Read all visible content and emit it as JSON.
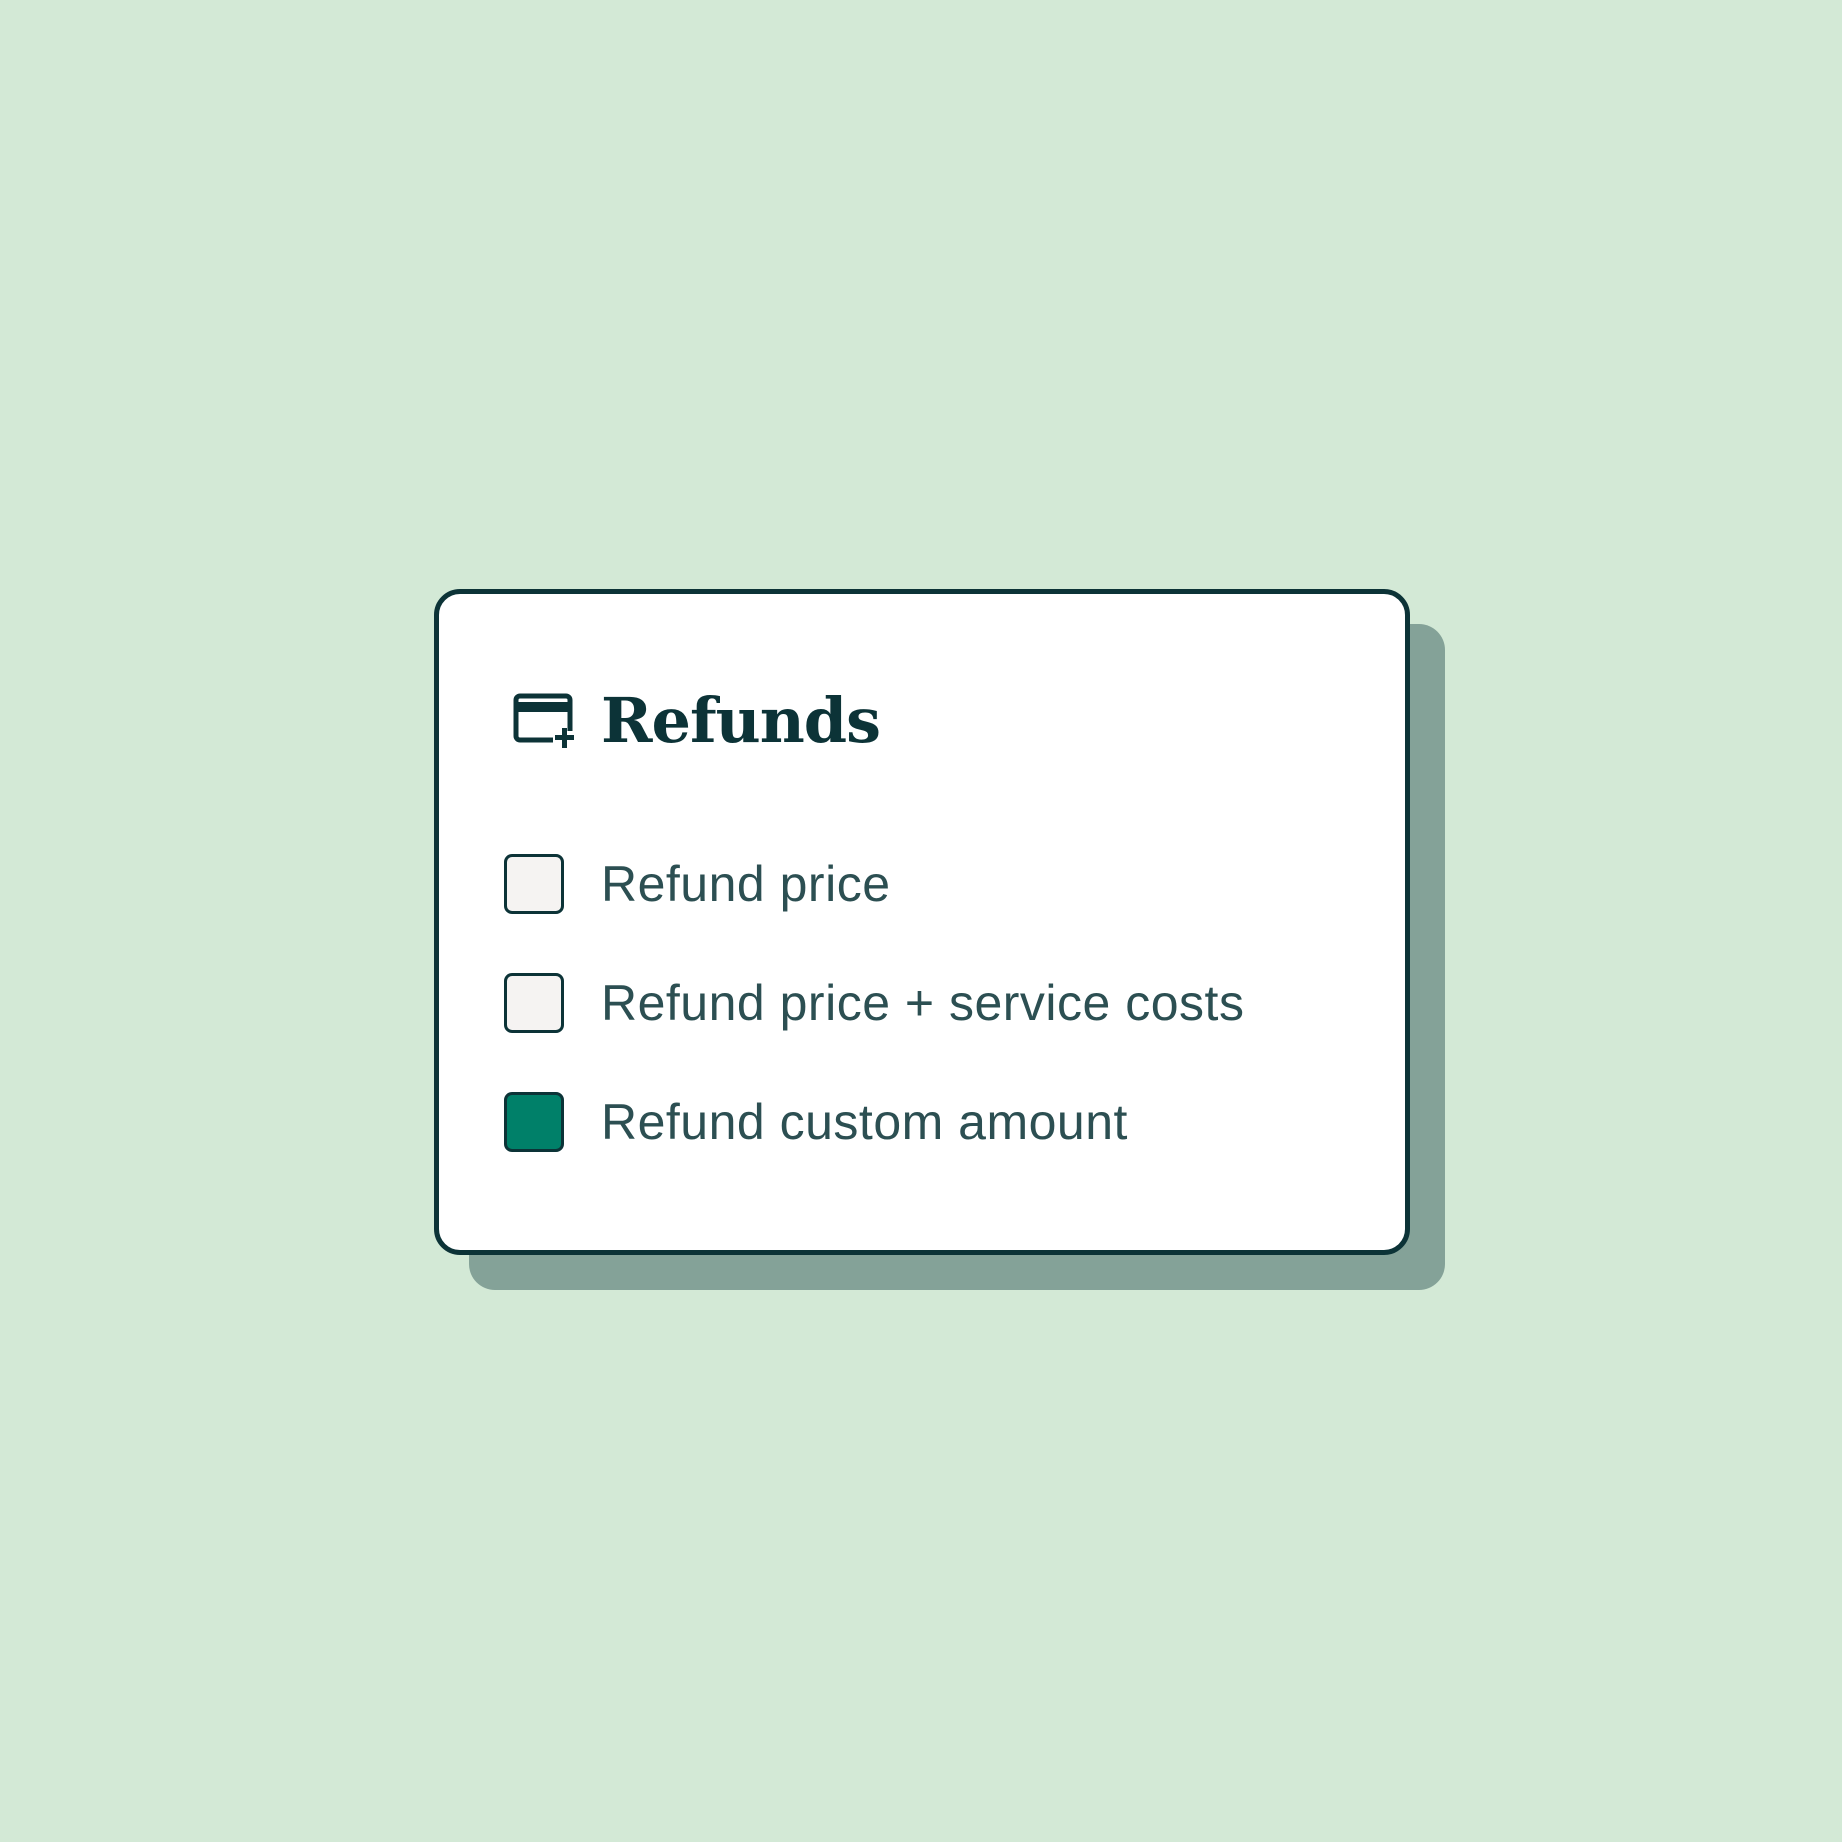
{
  "card": {
    "title": "Refunds",
    "icon": "credit-card-plus-icon"
  },
  "options": [
    {
      "label": "Refund price",
      "checked": false
    },
    {
      "label": "Refund price + service costs",
      "checked": false
    },
    {
      "label": "Refund custom amount",
      "checked": true
    }
  ],
  "colors": {
    "background": "#d3e9d6",
    "card_border": "#0c3337",
    "shadow": "#84a298",
    "checked_fill": "#008069",
    "unchecked_fill": "#f5f3f2",
    "label_text": "#2c4f52"
  }
}
